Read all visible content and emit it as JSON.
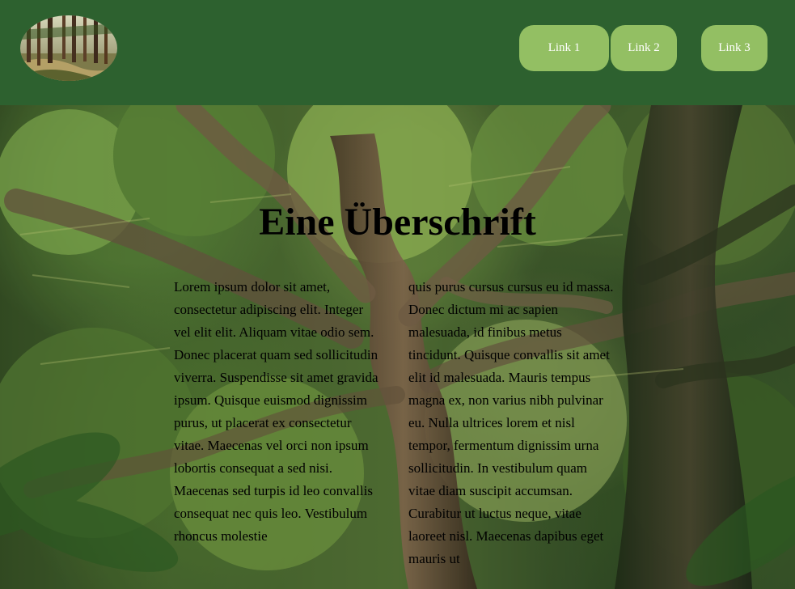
{
  "header": {
    "logo_icon": "forest-logo-icon",
    "links": [
      {
        "label": "Link 1"
      },
      {
        "label": "Link 2"
      },
      {
        "label": "Link 3"
      }
    ],
    "colors": {
      "header_background": "#2d612f",
      "link_background": "#93bf63",
      "link_text": "#ffffff"
    }
  },
  "hero": {
    "background_icon": "forest-background-image",
    "title": "Eine Überschrift",
    "text_left": "Lorem ipsum dolor sit amet, consectetur adipiscing elit. Integer vel elit elit. Aliquam vitae odio sem. Donec placerat quam sed sollicitudin viverra. Suspendisse sit amet gravida ipsum. Quisque euismod dignissim purus, ut placerat ex consectetur vitae. Maecenas vel orci non ipsum lobortis consequat a sed nisi. Maecenas sed turpis id leo convallis consequat nec quis leo. Vestibulum rhoncus molestie",
    "text_right": "quis purus cursus cursus eu id massa. Donec dictum mi ac sapien malesuada, id finibus metus tincidunt. Quisque convallis sit amet elit id malesuada. Mauris tempus magna ex, non varius nibh pulvinar eu. Nulla ultrices lorem et nisl tempor, fermentum dignissim urna sollicitudin. In vestibulum quam vitae diam suscipit accumsan. Curabitur ut luctus neque, vitae laoreet nisl. Maecenas dapibus eget mauris ut"
  }
}
